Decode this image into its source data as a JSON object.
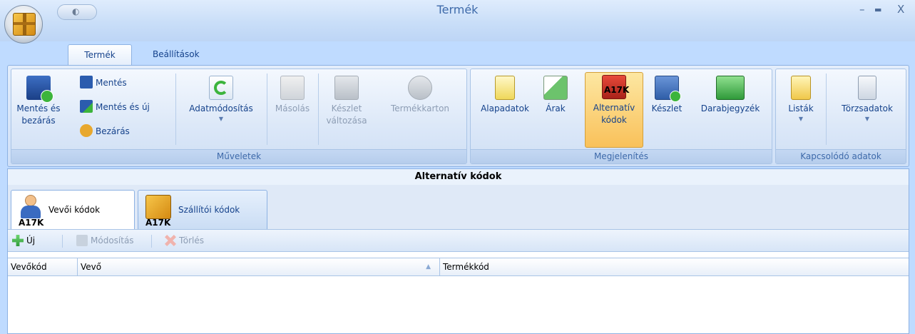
{
  "window": {
    "title": "Termék",
    "controls": {
      "minimize": "–",
      "maximize": "▬",
      "close": "X"
    },
    "qat_icon": "db-icon"
  },
  "tabs": [
    {
      "label": "Termék",
      "active": true
    },
    {
      "label": "Beállítások",
      "active": false
    }
  ],
  "ribbon": {
    "groups": {
      "muveletek": {
        "label": "Műveletek",
        "save_close": {
          "line1": "Mentés és",
          "line2": "bezárás"
        },
        "save": "Mentés",
        "save_new": "Mentés és új",
        "close": "Bezárás",
        "modify": "Adatmódosítás",
        "copy": "Másolás",
        "stock_change": {
          "line1": "Készlet",
          "line2": "változása"
        },
        "product_card": "Termékkarton"
      },
      "megjelenites": {
        "label": "Megjelenítés",
        "basic": "Alapadatok",
        "prices": "Árak",
        "alt_codes": {
          "line1": "Alternatív",
          "line2": "kódok",
          "badge": "A17K"
        },
        "stock": "Készlet",
        "bom": "Darabjegyzék"
      },
      "kapcsolodo": {
        "label": "Kapcsolódó adatok",
        "lists": "Listák",
        "master": "Törzsadatok"
      }
    }
  },
  "panel": {
    "title": "Alternatív kódok",
    "tabs": [
      {
        "label": "Vevői kódok",
        "badge": "A17K",
        "active": true
      },
      {
        "label": "Szállítói kódok",
        "badge": "A17K",
        "active": false
      }
    ],
    "toolbar": {
      "new": "Új",
      "modify": "Módosítás",
      "delete": "Törlés"
    },
    "columns": [
      "Vevőkód",
      "Vevő",
      "Termékkód"
    ]
  },
  "colors": {
    "ribbon_bg": "#dce8f8",
    "selected": "#f9c15a",
    "title": "#3e6aaa"
  }
}
